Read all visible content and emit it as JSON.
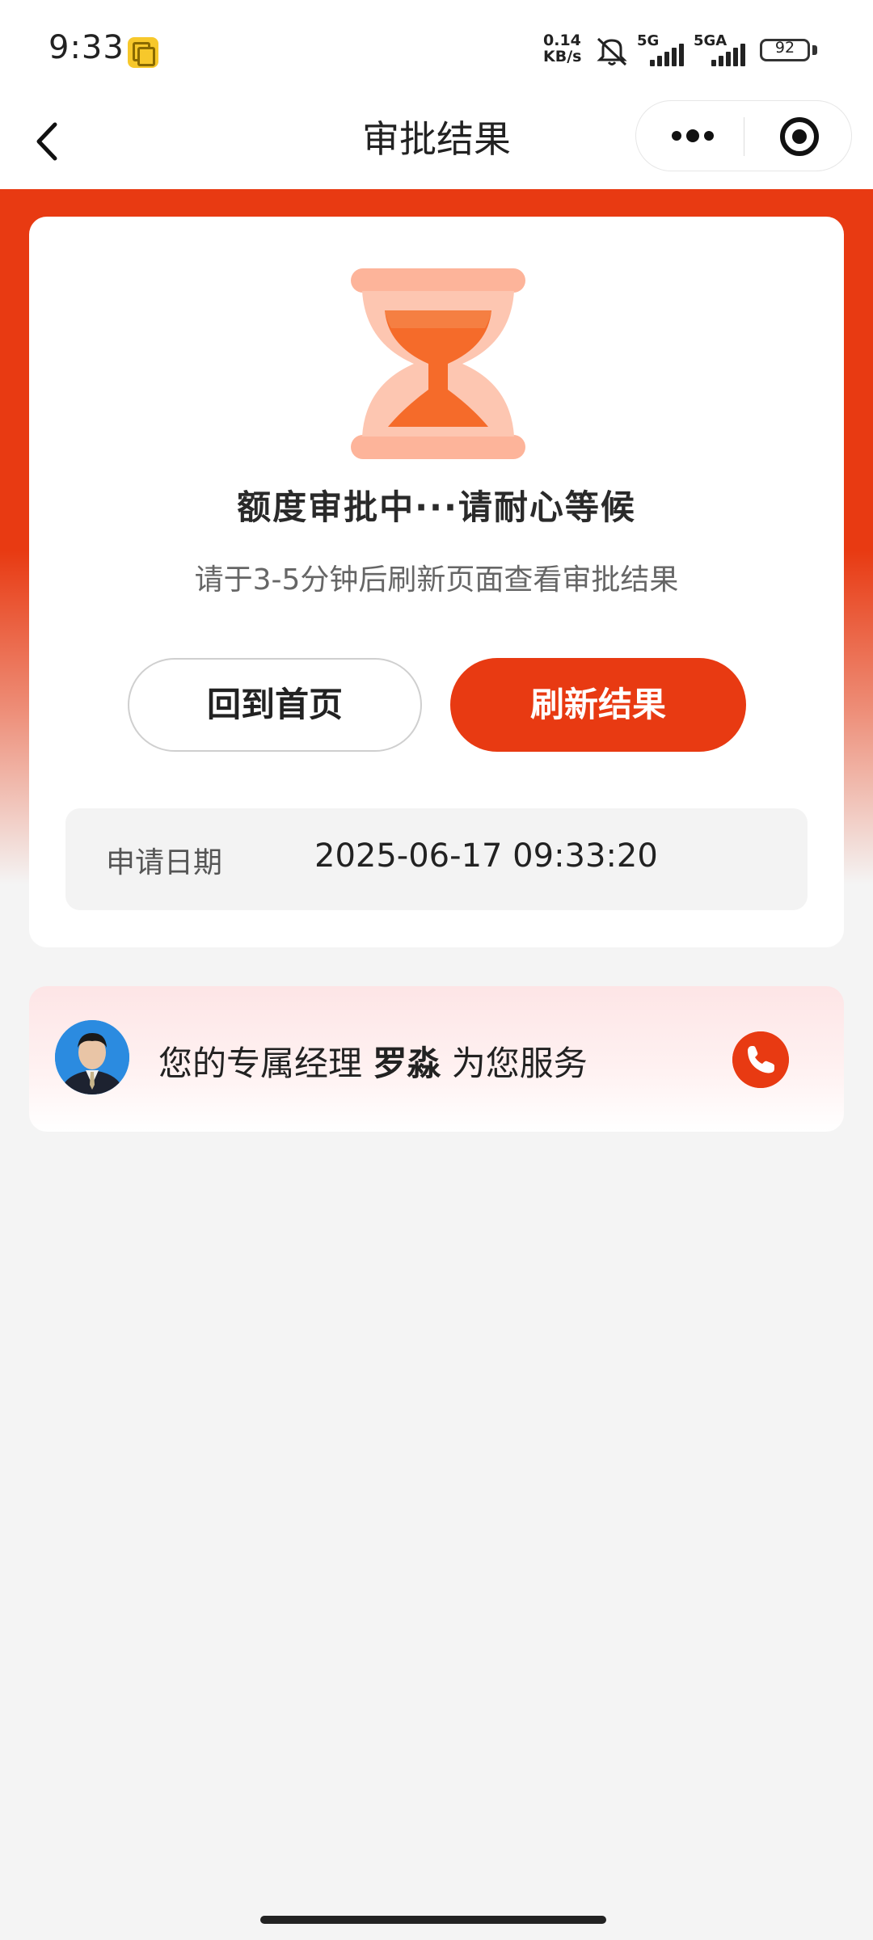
{
  "status_bar": {
    "time": "9:33",
    "net_speed_value": "0.14",
    "net_speed_unit": "KB/s",
    "sim1_label": "5G",
    "sim2_label": "5GA",
    "battery": "92"
  },
  "nav": {
    "title": "审批结果"
  },
  "approval": {
    "status_title": "额度审批中···请耐心等候",
    "status_sub": "请于3-5分钟后刷新页面查看审批结果",
    "home_label": "回到首页",
    "refresh_label": "刷新结果",
    "date_label": "申请日期",
    "date_value": "2025-06-17 09:33:20"
  },
  "manager": {
    "prefix": "您的专属经理 ",
    "name": "罗淼",
    "suffix": " 为您服务"
  },
  "colors": {
    "accent": "#e83a12",
    "hourglass_light": "#fdb49a",
    "hourglass_dark": "#f56b2a"
  },
  "icons": [
    "back-icon",
    "more-icon",
    "target-icon",
    "hourglass-icon",
    "phone-icon",
    "bell-muted-icon"
  ]
}
